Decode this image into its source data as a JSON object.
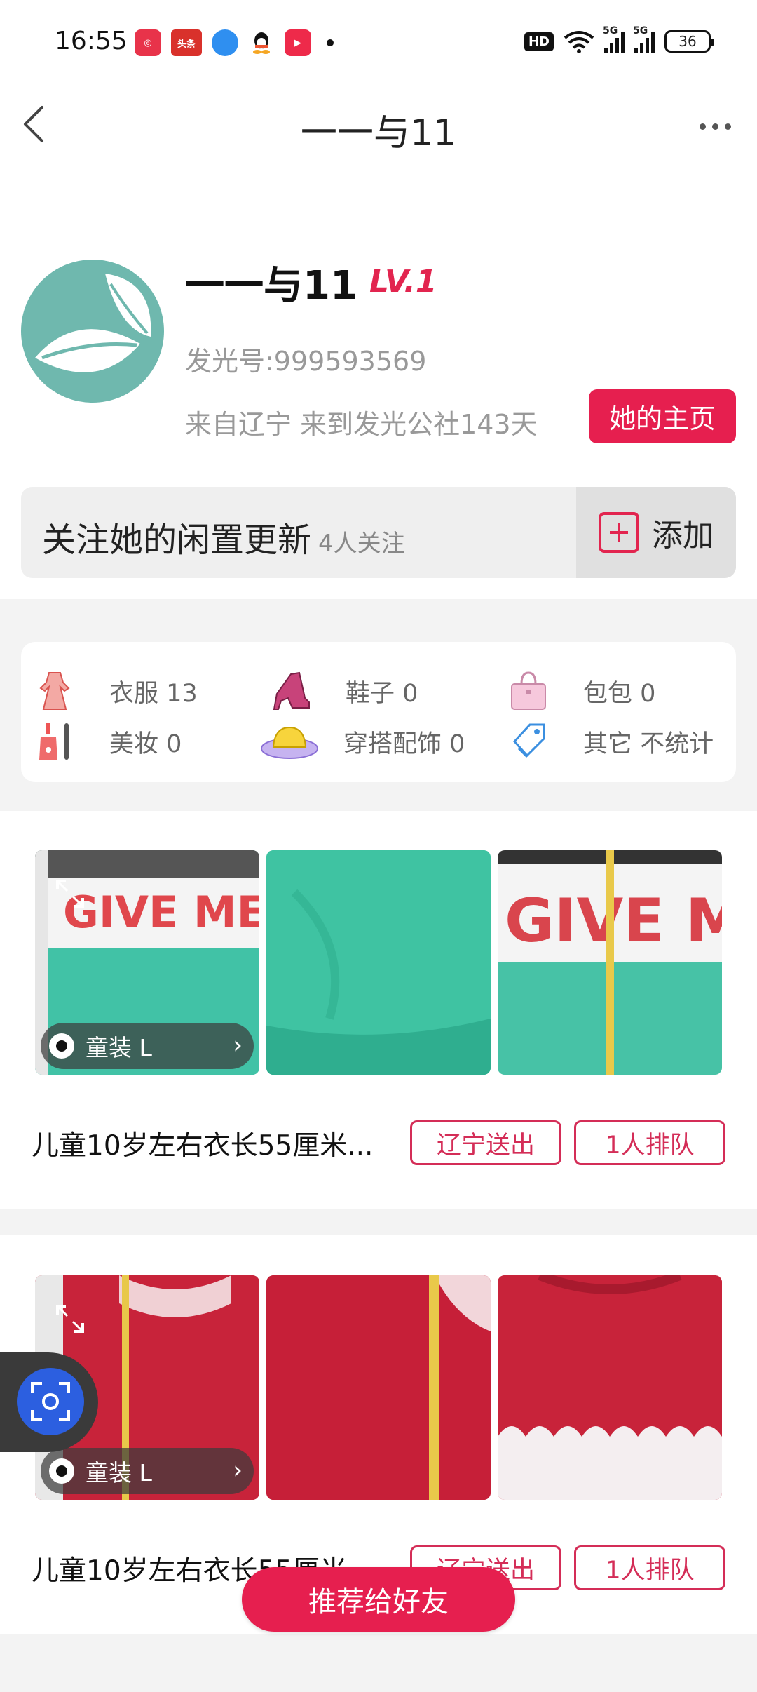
{
  "status_bar": {
    "time": "16:55",
    "battery": "36",
    "hd_label": "HD",
    "network": [
      "5G",
      "5G"
    ]
  },
  "header": {
    "title": "一一与11"
  },
  "profile": {
    "name": "一一与11",
    "level": "LV.1",
    "faguang_id": "发光号:999593569",
    "from_text": "来自辽宁 来到发光公社143天",
    "home_button": "她的主页"
  },
  "follow": {
    "label": "关注她的闲置更新",
    "count": "4人关注",
    "add_button": "添加"
  },
  "categories": [
    {
      "label": "衣服 13",
      "icon": "dress-icon"
    },
    {
      "label": "鞋子 0",
      "icon": "high-heel-icon"
    },
    {
      "label": "包包 0",
      "icon": "handbag-icon"
    },
    {
      "label": "美妆 0",
      "icon": "cosmetics-icon"
    },
    {
      "label": "穿搭配饰 0",
      "icon": "hat-icon"
    },
    {
      "label": "其它 不统计",
      "icon": "tag-icon"
    }
  ],
  "items": [
    {
      "tag": "童装 L",
      "title": "儿童10岁左右衣长55厘米...",
      "location_btn": "辽宁送出",
      "queue_btn": "1人排队"
    },
    {
      "tag": "童装 L",
      "title": "儿童10岁左右衣长55厘米",
      "location_btn": "辽宁送出",
      "queue_btn": "1人排队"
    }
  ],
  "share_button": "推荐给好友",
  "colors": {
    "accent": "#e61f4f",
    "avatar_bg": "#6fb8ae",
    "scan_button": "#2c5fe0"
  }
}
